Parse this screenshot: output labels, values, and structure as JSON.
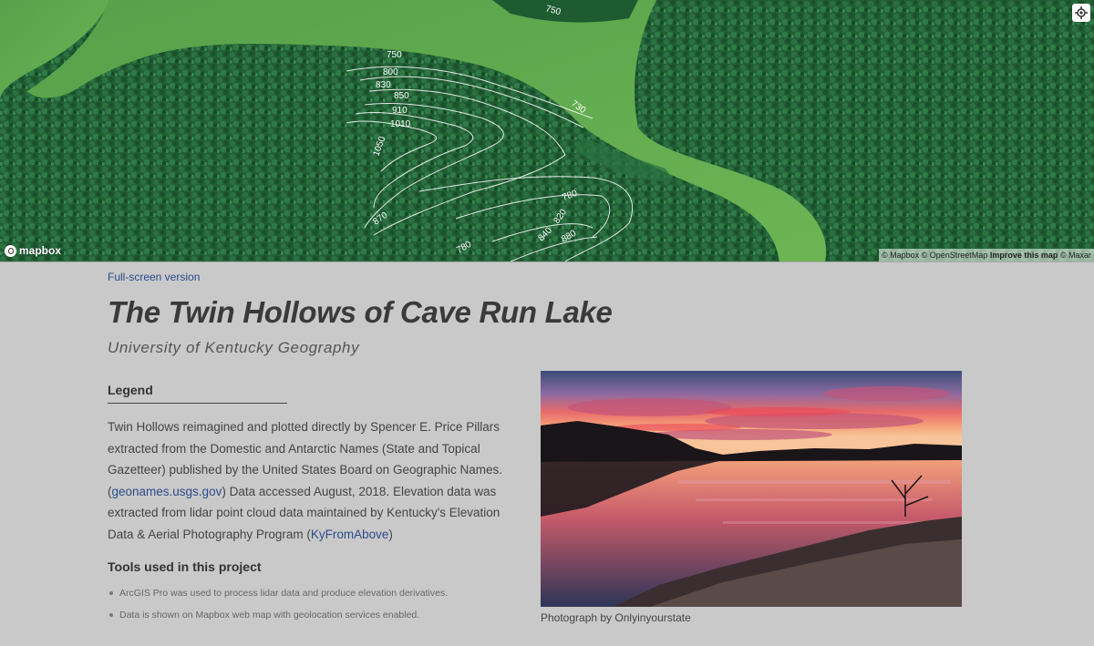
{
  "map": {
    "logo_text": "mapbox",
    "attribution": {
      "mapbox": "© Mapbox",
      "osm": "© OpenStreetMap",
      "improve": "Improve this map",
      "maxar": "© Maxar"
    },
    "contour_labels": [
      "750",
      "750",
      "800",
      "830",
      "850",
      "910",
      "1010",
      "1050",
      "730",
      "870",
      "780",
      "820",
      "840",
      "880",
      "780"
    ],
    "colors": {
      "forest": "#1f5f34",
      "water": "#5fa84e",
      "contour": "#ffffff"
    }
  },
  "header": {
    "fullscreen_link": "Full-screen version",
    "title": "The Twin Hollows of Cave Run Lake",
    "subtitle": "University of Kentucky Geography"
  },
  "legend": {
    "heading": "Legend",
    "text_1": "Twin Hollows reimagined and plotted directly by Spencer E. Price Pillars extracted from the Domestic and Antarctic Names (State and Topical Gazetteer) published by the United States Board on Geographic Names. (",
    "link_1": "geonames.usgs.gov",
    "text_2": ") Data accessed August, 2018. Elevation data was extracted from lidar point cloud data maintained by Kentucky's Elevation Data & Aerial Photography Program (",
    "link_2": "KyFromAbove",
    "text_3": ")"
  },
  "tools": {
    "heading": "Tools used in this project",
    "items": [
      "ArcGIS Pro was used to process lidar data and produce elevation derivatives.",
      "Data is shown on Mapbox web map with geolocation services enabled."
    ]
  },
  "photo": {
    "caption": "Photograph by Onlyinyourstate"
  }
}
